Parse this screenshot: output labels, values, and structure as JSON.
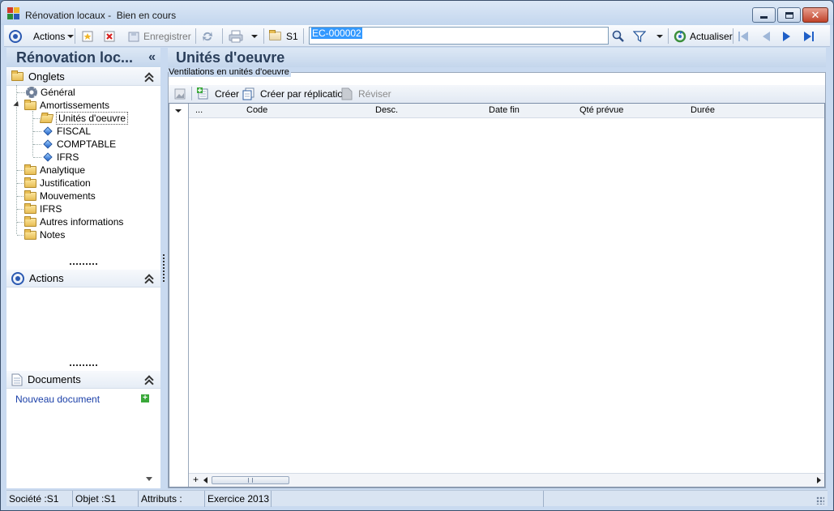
{
  "window": {
    "title_part1": "Rénovation locaux -",
    "title_part2": "Bien en cours"
  },
  "toolbar": {
    "actions_label": "Actions",
    "save_label": "Enregistrer",
    "s1_label": "S1",
    "record_value": "EC-000002",
    "refresh_label": "Actualiser"
  },
  "left": {
    "header": "Rénovation loc...",
    "collapse_glyph": "«",
    "sections": {
      "tabs": "Onglets",
      "actions": "Actions",
      "documents": "Documents"
    },
    "tree": [
      {
        "label": "Général",
        "icon": "gear-icon"
      },
      {
        "label": "Amortissements",
        "icon": "folder-icon"
      },
      {
        "label": "Unités d'oeuvre",
        "icon": "folder-open-icon"
      },
      {
        "label": "FISCAL",
        "icon": "diamond-icon"
      },
      {
        "label": "COMPTABLE",
        "icon": "diamond-icon"
      },
      {
        "label": "IFRS",
        "icon": "diamond-icon"
      },
      {
        "label": "Analytique",
        "icon": "folder-icon"
      },
      {
        "label": "Justification",
        "icon": "folder-icon"
      },
      {
        "label": "Mouvements",
        "icon": "folder-icon"
      },
      {
        "label": "IFRS",
        "icon": "folder-icon"
      },
      {
        "label": "Autres informations",
        "icon": "folder-icon"
      },
      {
        "label": "Notes",
        "icon": "folder-icon"
      }
    ],
    "new_document": "Nouveau document"
  },
  "main": {
    "title": "Unités d'oeuvre",
    "group_label": "Ventilations en unités d'oeuvre",
    "create_label": "Créer",
    "create_replication_label": "Créer par réplication",
    "review_label": "Réviser",
    "columns": [
      "...",
      "Code",
      "Desc.",
      "Date fin",
      "Qté prévue",
      "Durée"
    ],
    "footer_plus": "+"
  },
  "statusbar": {
    "company": "Société :S1",
    "object": "Objet :S1",
    "attributes": "Attributs :",
    "fiscal_year": "Exercice 2013"
  }
}
